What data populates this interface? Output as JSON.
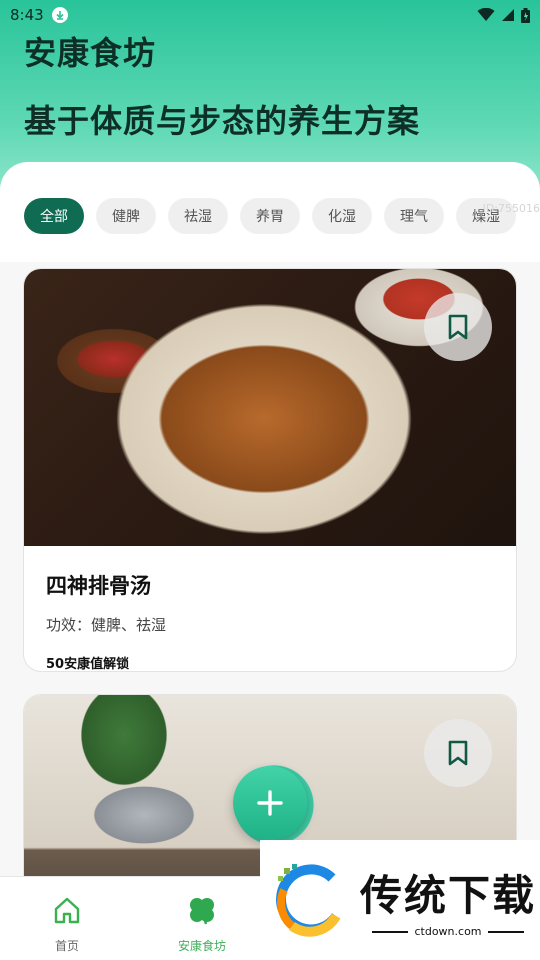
{
  "status_bar": {
    "time": "8:43"
  },
  "header": {
    "title": "安康食坊",
    "subtitle": "基于体质与步态的养生方案"
  },
  "filters": {
    "chips": [
      "全部",
      "健脾",
      "祛湿",
      "养胃",
      "化湿",
      "理气",
      "燥湿"
    ],
    "selected": "全部",
    "watermark": "ID:755016"
  },
  "recipes": [
    {
      "name": "四神排骨汤",
      "effect": "功效：健脾、祛湿",
      "unlock": "50安康值解锁"
    }
  ],
  "fab": {
    "icon": "plus-icon"
  },
  "bottom_nav": {
    "items": [
      {
        "label": "首页",
        "icon": "home-icon"
      },
      {
        "label": "安康食坊",
        "icon": "clover-icon"
      }
    ]
  },
  "promo": {
    "title": "传统下载",
    "url": "ctdown.com"
  },
  "colors": {
    "header_top": "#29c49a",
    "active_chip": "#0f6b52",
    "fab": "#2cc494",
    "nav_active": "#3fae5c"
  }
}
